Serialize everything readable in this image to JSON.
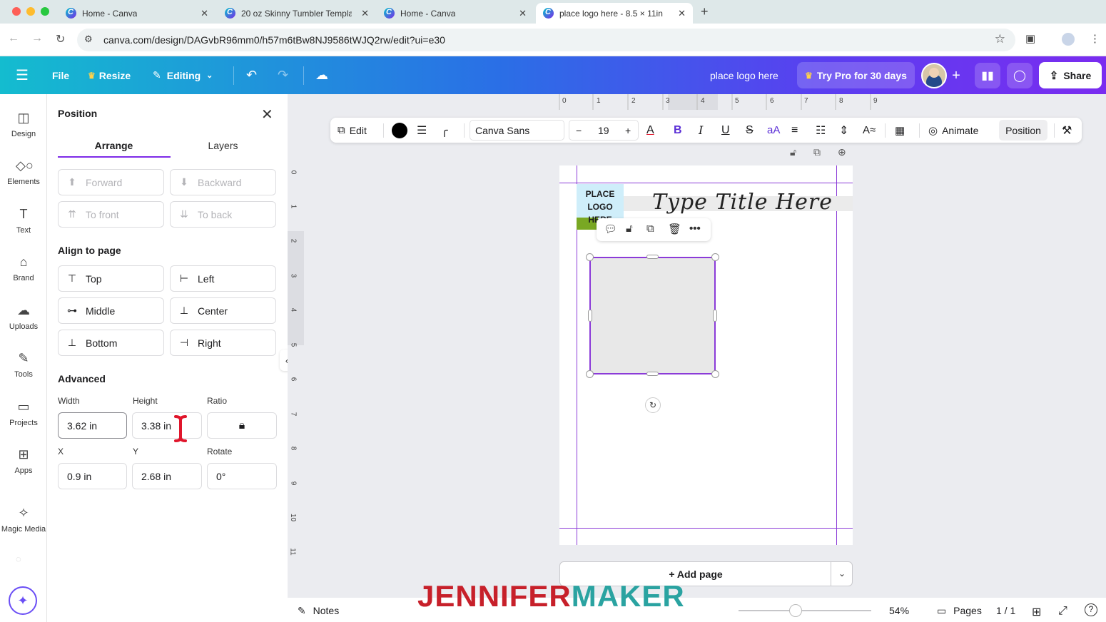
{
  "browser": {
    "tabs": [
      {
        "title": "Home - Canva",
        "active": false
      },
      {
        "title": "20 oz Skinny Tumbler Templa",
        "active": false
      },
      {
        "title": "Home - Canva",
        "active": false
      },
      {
        "title": "place logo here - 8.5 × 11in",
        "active": true
      }
    ],
    "url": "canva.com/design/DAGvbR96mm0/h57m6tBw8NJ9586tWJQ2rw/edit?ui=e30"
  },
  "header": {
    "file": "File",
    "resize": "Resize",
    "editing": "Editing",
    "design_title": "place logo here",
    "try_pro": "Try Pro for 30 days",
    "share": "Share",
    "gradient_start": "#14bccf",
    "gradient_end": "#7a2cf0"
  },
  "rail": [
    {
      "label": "Design",
      "icon": "design-icon"
    },
    {
      "label": "Elements",
      "icon": "elements-icon"
    },
    {
      "label": "Text",
      "icon": "text-icon"
    },
    {
      "label": "Brand",
      "icon": "brand-icon"
    },
    {
      "label": "Uploads",
      "icon": "uploads-icon"
    },
    {
      "label": "Tools",
      "icon": "tools-icon"
    },
    {
      "label": "Projects",
      "icon": "projects-icon"
    },
    {
      "label": "Apps",
      "icon": "apps-icon"
    },
    {
      "label": "Magic Media",
      "icon": "magic-media-icon"
    }
  ],
  "panel": {
    "title": "Position",
    "tabs": [
      "Arrange",
      "Layers"
    ],
    "order_buttons": [
      "Forward",
      "Backward",
      "To front",
      "To back"
    ],
    "align_heading": "Align to page",
    "align_buttons": [
      "Top",
      "Left",
      "Middle",
      "Center",
      "Bottom",
      "Right"
    ],
    "advanced_heading": "Advanced",
    "width_label": "Width",
    "height_label": "Height",
    "ratio_label": "Ratio",
    "x_label": "X",
    "y_label": "Y",
    "rotate_label": "Rotate",
    "width": "3.62 in",
    "height": "3.38 in",
    "x": "0.9 in",
    "y": "2.68 in",
    "rotate": "0°"
  },
  "toolbar": {
    "edit": "Edit",
    "font": "Canva Sans",
    "font_size": "19",
    "minus": "−",
    "plus": "+",
    "animate": "Animate",
    "position": "Position",
    "case_label": "aA",
    "text_color": "#000000"
  },
  "ruler": {
    "top": [
      "0",
      "1",
      "2",
      "3",
      "4",
      "5",
      "6",
      "7",
      "8",
      "9"
    ],
    "left": [
      "0",
      "1",
      "2",
      "3",
      "4",
      "5",
      "6",
      "7",
      "8",
      "9",
      "10",
      "11"
    ]
  },
  "canvas": {
    "logo_text": "PLACE\nLOGO\nHERE",
    "script_title": "Type Title Here",
    "add_page": "+ Add page"
  },
  "bottom": {
    "notes": "Notes",
    "zoom": "54%",
    "zoom_fraction": 0.43,
    "pages": "Pages",
    "page_count": "1 / 1"
  },
  "watermark": {
    "part1": "JENNIFER",
    "part2": "MAKER"
  }
}
